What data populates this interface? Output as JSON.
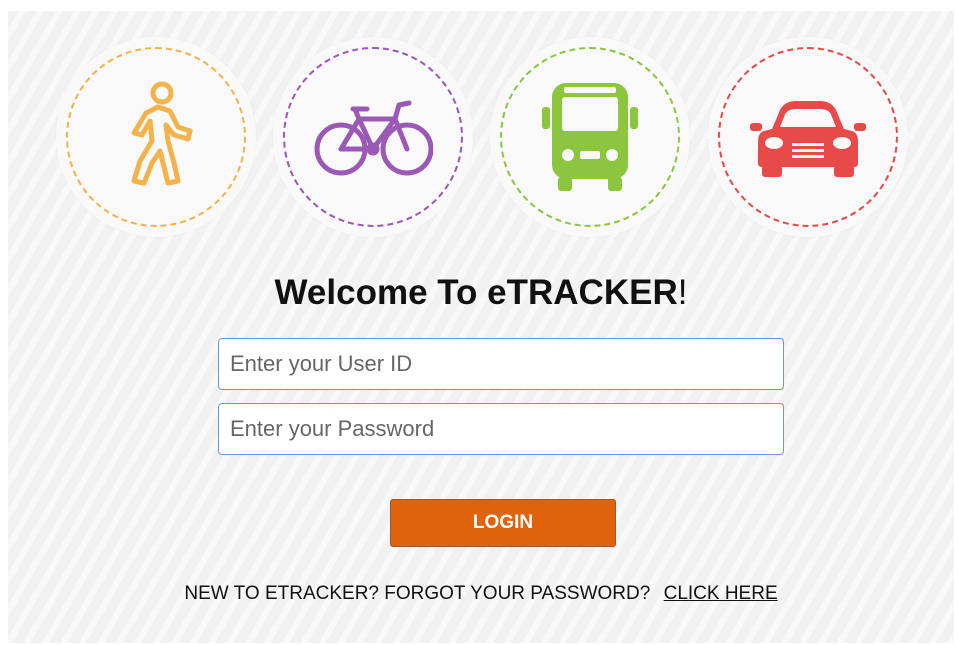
{
  "modes": [
    {
      "name": "walk-icon",
      "color": "#f3b34b"
    },
    {
      "name": "bicycle-icon",
      "color": "#9b59b6"
    },
    {
      "name": "bus-icon",
      "color": "#8cc63f"
    },
    {
      "name": "car-icon",
      "color": "#e84a4a"
    }
  ],
  "header": {
    "title_main": "Welcome To eTRACKER",
    "title_bang": "!"
  },
  "form": {
    "userid_placeholder": "Enter your User ID",
    "password_placeholder": "Enter your Password",
    "login_label": "LOGIN"
  },
  "footer": {
    "prompt": "NEW TO ETRACKER? FORGOT YOUR PASSWORD?",
    "link_label": "CLICK HERE"
  },
  "colors": {
    "accent": "#e0620d",
    "input_border": "#6d97d6"
  }
}
